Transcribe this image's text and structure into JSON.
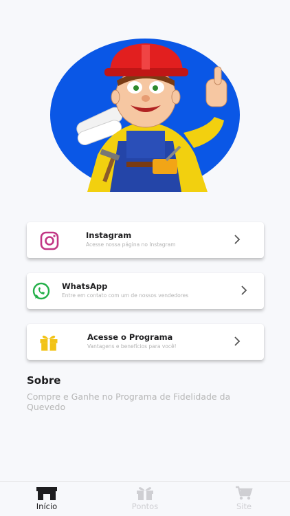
{
  "cards": [
    {
      "title": "Instagram",
      "subtitle": "Acesse nossa página no Instagram",
      "icon": "instagram-icon"
    },
    {
      "title": "WhatsApp",
      "subtitle": "Entre em contato com um de nossos vendedores",
      "icon": "whatsapp-icon"
    },
    {
      "title": "Acesse o Programa",
      "subtitle": "Vantagens e benefícios para você!",
      "icon": "gift-icon"
    }
  ],
  "about": {
    "title": "Sobre",
    "text": "Compre e Ganhe no Programa de Fidelidade da Quevedo"
  },
  "tabs": [
    {
      "label": "Início",
      "icon": "store-icon",
      "active": true
    },
    {
      "label": "Pontos",
      "icon": "gift-icon",
      "active": false
    },
    {
      "label": "Site",
      "icon": "cart-icon",
      "active": false
    }
  ],
  "colors": {
    "logo_blue": "#0a57e6",
    "instagram": "#c13584",
    "whatsapp": "#25b04a",
    "gift": "#f2c316",
    "active_tab": "#1d1d1f",
    "inactive_tab": "#cfcfd3"
  }
}
